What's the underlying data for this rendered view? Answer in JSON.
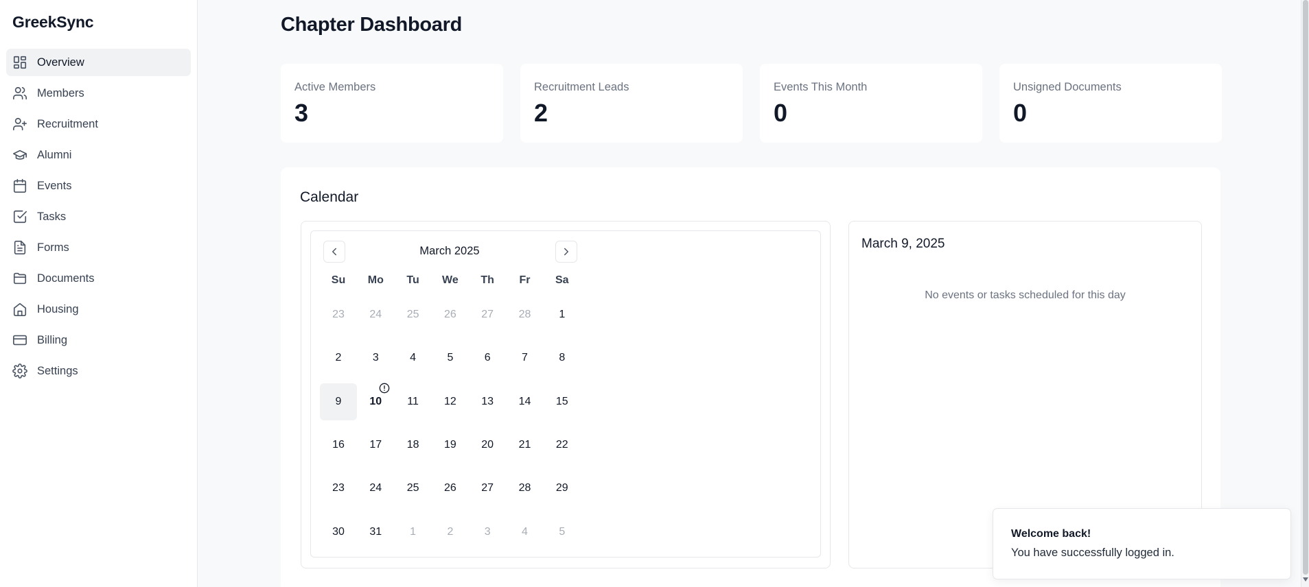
{
  "app": {
    "brand": "GreekSync"
  },
  "sidebar": {
    "items": [
      {
        "label": "Overview",
        "icon": "dashboard-icon",
        "active": true
      },
      {
        "label": "Members",
        "icon": "users-icon",
        "active": false
      },
      {
        "label": "Recruitment",
        "icon": "user-plus-icon",
        "active": false
      },
      {
        "label": "Alumni",
        "icon": "graduation-cap-icon",
        "active": false
      },
      {
        "label": "Events",
        "icon": "calendar-icon",
        "active": false
      },
      {
        "label": "Tasks",
        "icon": "checkbox-icon",
        "active": false
      },
      {
        "label": "Forms",
        "icon": "file-text-icon",
        "active": false
      },
      {
        "label": "Documents",
        "icon": "folder-icon",
        "active": false
      },
      {
        "label": "Housing",
        "icon": "home-icon",
        "active": false
      },
      {
        "label": "Billing",
        "icon": "credit-card-icon",
        "active": false
      },
      {
        "label": "Settings",
        "icon": "gear-icon",
        "active": false
      }
    ]
  },
  "page": {
    "title": "Chapter Dashboard"
  },
  "stats": [
    {
      "label": "Active Members",
      "value": "3"
    },
    {
      "label": "Recruitment Leads",
      "value": "2"
    },
    {
      "label": "Events This Month",
      "value": "0"
    },
    {
      "label": "Unsigned Documents",
      "value": "0"
    }
  ],
  "calendar": {
    "title": "Calendar",
    "month_label": "March 2025",
    "weekdays": [
      "Su",
      "Mo",
      "Tu",
      "We",
      "Th",
      "Fr",
      "Sa"
    ],
    "weeks": [
      [
        {
          "d": "23",
          "muted": true
        },
        {
          "d": "24",
          "muted": true
        },
        {
          "d": "25",
          "muted": true
        },
        {
          "d": "26",
          "muted": true
        },
        {
          "d": "27",
          "muted": true
        },
        {
          "d": "28",
          "muted": true
        },
        {
          "d": "1"
        }
      ],
      [
        {
          "d": "2"
        },
        {
          "d": "3"
        },
        {
          "d": "4"
        },
        {
          "d": "5"
        },
        {
          "d": "6"
        },
        {
          "d": "7"
        },
        {
          "d": "8"
        }
      ],
      [
        {
          "d": "9",
          "selected": true
        },
        {
          "d": "10",
          "today": true,
          "marker": true
        },
        {
          "d": "11"
        },
        {
          "d": "12"
        },
        {
          "d": "13"
        },
        {
          "d": "14"
        },
        {
          "d": "15"
        }
      ],
      [
        {
          "d": "16"
        },
        {
          "d": "17"
        },
        {
          "d": "18"
        },
        {
          "d": "19"
        },
        {
          "d": "20"
        },
        {
          "d": "21"
        },
        {
          "d": "22"
        }
      ],
      [
        {
          "d": "23"
        },
        {
          "d": "24"
        },
        {
          "d": "25"
        },
        {
          "d": "26"
        },
        {
          "d": "27"
        },
        {
          "d": "28"
        },
        {
          "d": "29"
        }
      ],
      [
        {
          "d": "30"
        },
        {
          "d": "31"
        },
        {
          "d": "1",
          "muted": true
        },
        {
          "d": "2",
          "muted": true
        },
        {
          "d": "3",
          "muted": true
        },
        {
          "d": "4",
          "muted": true
        },
        {
          "d": "5",
          "muted": true
        }
      ]
    ]
  },
  "details": {
    "date": "March 9, 2025",
    "empty_message": "No events or tasks scheduled for this day"
  },
  "toast": {
    "title": "Welcome back!",
    "message": "You have successfully logged in."
  },
  "colors": {
    "background": "#f8f9fb",
    "surface": "#ffffff",
    "border": "#e5e7eb",
    "text": "#111827",
    "muted_text": "#6b7280"
  }
}
